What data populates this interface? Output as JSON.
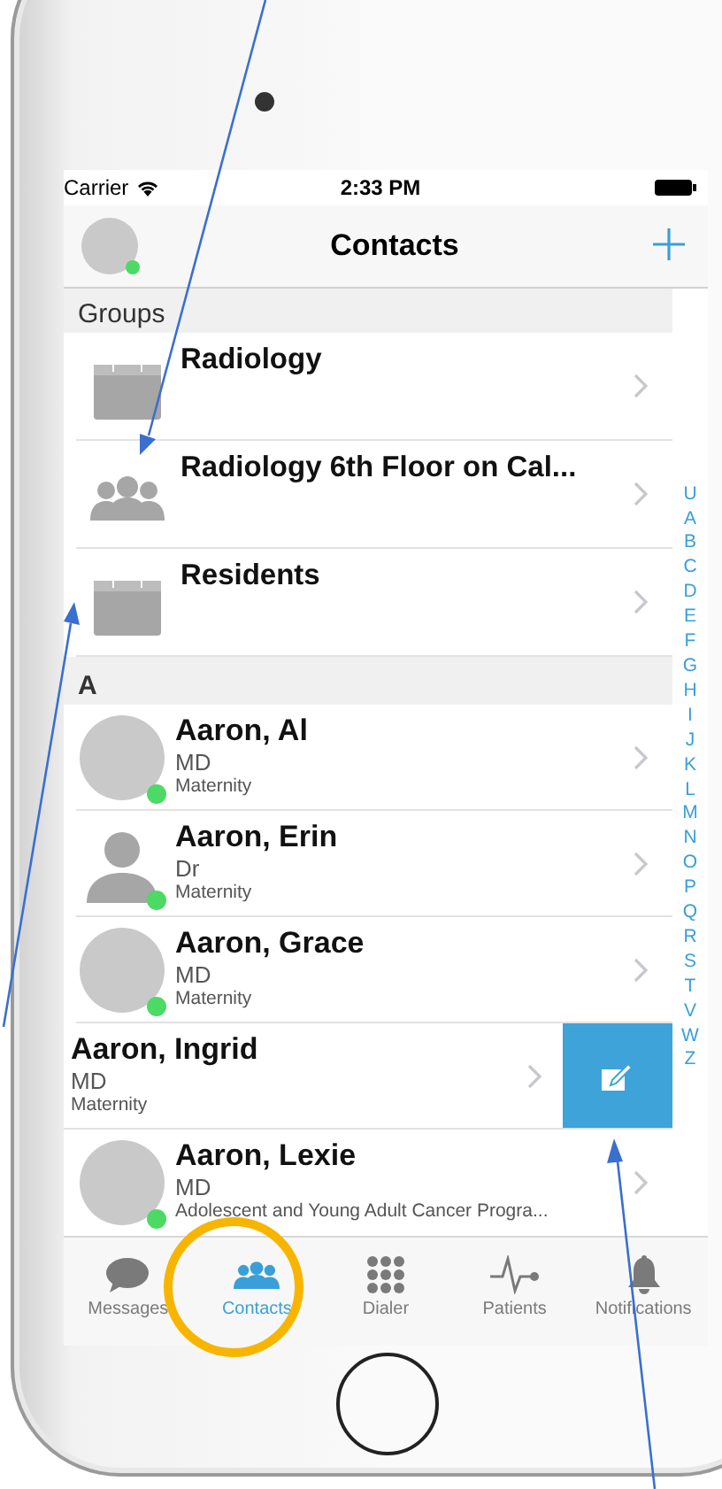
{
  "status_bar": {
    "carrier": "Carrier",
    "time": "2:33 PM"
  },
  "nav_bar": {
    "title": "Contacts",
    "profile_online": true
  },
  "sections": [
    {
      "header": "Groups",
      "rows": [
        {
          "kind": "calendar",
          "name": "Radiology"
        },
        {
          "kind": "people",
          "name": "Radiology 6th Floor on Cal..."
        },
        {
          "kind": "calendar",
          "name": "Residents"
        }
      ]
    },
    {
      "header": "A",
      "rows": [
        {
          "kind": "photo",
          "name": "Aaron, Al",
          "title": "MD",
          "department": "Maternity",
          "online": true,
          "swiped": false
        },
        {
          "kind": "silhouette",
          "name": "Aaron, Erin",
          "title": "Dr",
          "department": "Maternity",
          "online": true,
          "swiped": false
        },
        {
          "kind": "photo",
          "name": "Aaron, Grace",
          "title": "MD",
          "department": "Maternity",
          "online": true,
          "swiped": false
        },
        {
          "name": "Aaron, Ingrid",
          "title": "MD",
          "department": "Maternity",
          "swiped": true
        },
        {
          "kind": "photo",
          "name": "Aaron, Lexie",
          "title": "MD",
          "department": "Adolescent and Young Adult Cancer Progra...",
          "online": true,
          "swiped": false
        }
      ]
    }
  ],
  "index_letters": [
    "U",
    "A",
    "B",
    "C",
    "D",
    "E",
    "F",
    "G",
    "H",
    "I",
    "J",
    "K",
    "L",
    "M",
    "N",
    "O",
    "P",
    "Q",
    "R",
    "S",
    "T",
    "V",
    "W",
    "Z"
  ],
  "tabs": [
    {
      "label": "Messages",
      "selected": false
    },
    {
      "label": "Contacts",
      "selected": true
    },
    {
      "label": "Dialer",
      "selected": false
    },
    {
      "label": "Patients",
      "selected": false
    },
    {
      "label": "Notifications",
      "selected": false
    }
  ]
}
